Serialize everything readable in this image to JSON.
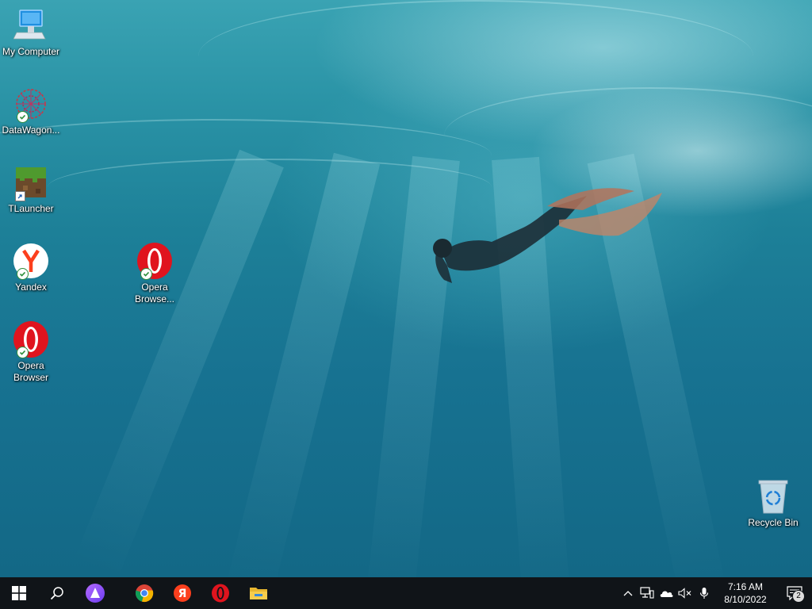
{
  "desktop": {
    "icons": [
      {
        "label": "My Computer",
        "icon": "computer-icon"
      },
      {
        "label": "DataWagon...",
        "icon": "datawagon-icon"
      },
      {
        "label": "TLauncher",
        "icon": "tlauncher-icon"
      },
      {
        "label": "Yandex",
        "icon": "yandex-icon"
      },
      {
        "label": "Opera Browse...",
        "icon": "opera-icon"
      },
      {
        "label": "Opera Browser",
        "icon": "opera-icon"
      },
      {
        "label": "Recycle Bin",
        "icon": "recycle-bin-icon"
      }
    ]
  },
  "taskbar": {
    "pinned": [
      {
        "name": "start",
        "icon": "windows-logo-icon"
      },
      {
        "name": "search",
        "icon": "search-icon"
      },
      {
        "name": "alice",
        "icon": "alice-assistant-icon"
      },
      {
        "name": "chrome",
        "icon": "chrome-icon"
      },
      {
        "name": "yandex",
        "icon": "yandex-browser-icon"
      },
      {
        "name": "opera",
        "icon": "opera-icon"
      },
      {
        "name": "file-explorer",
        "icon": "folder-icon"
      }
    ],
    "tray": {
      "icons": [
        "chevron-up-icon",
        "network-icon",
        "onedrive-cloud-icon",
        "volume-muted-icon",
        "microphone-icon"
      ],
      "time": "7:16 AM",
      "date": "8/10/2022",
      "notification_count": "2"
    }
  },
  "colors": {
    "taskbar": "#101418",
    "opera_red": "#e0141e",
    "yandex_red": "#fc3f1d",
    "sync_green": "#2f8f3c"
  }
}
